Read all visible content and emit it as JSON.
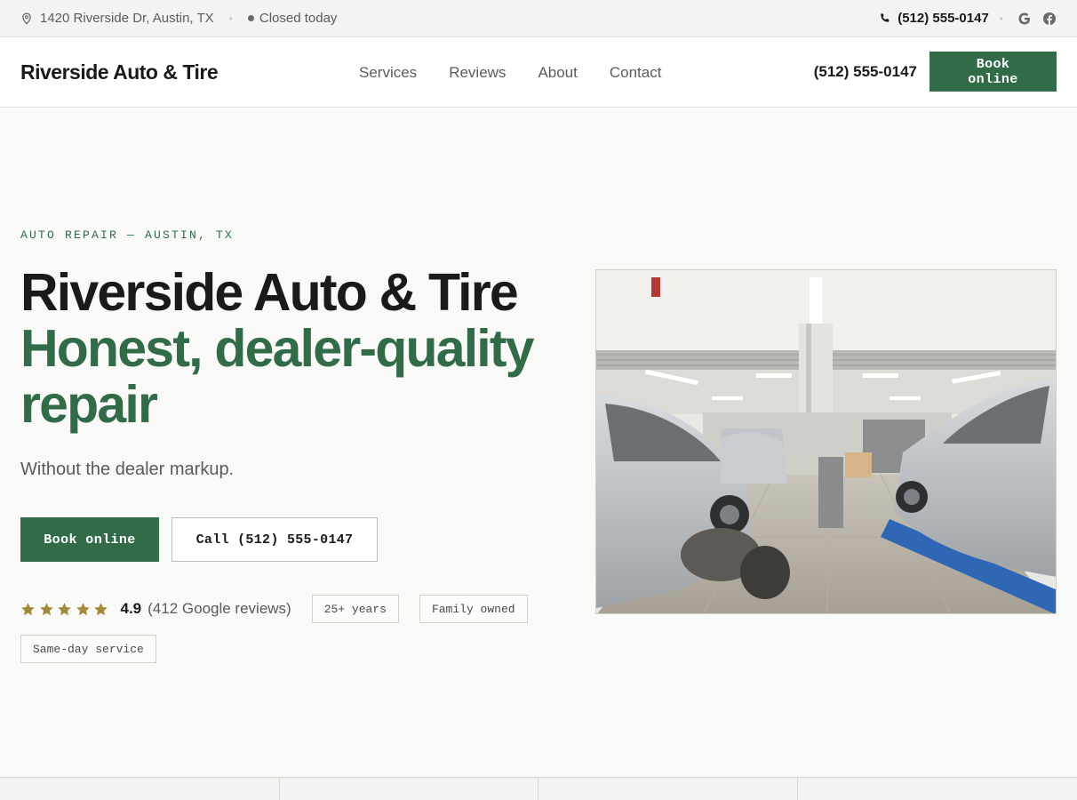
{
  "topbar": {
    "address": "1420 Riverside Dr, Austin, TX",
    "status": "Closed today",
    "phone": "(512) 555-0147",
    "icons": [
      "map-pin-icon",
      "phone-icon",
      "google-icon",
      "facebook-icon"
    ]
  },
  "header": {
    "brand": "Riverside Auto & Tire",
    "nav": [
      "Services",
      "Reviews",
      "About",
      "Contact"
    ],
    "phone": "(512) 555-0147",
    "book_label": "Book online"
  },
  "hero": {
    "eyebrow": "AUTO REPAIR — AUSTIN, TX",
    "headline_line1": "Riverside Auto & Tire",
    "headline_line2": "Honest, dealer-quality repair",
    "subhead": "Without the dealer markup.",
    "primary_cta": "Book online",
    "secondary_cta": "Call (512) 555-0147",
    "rating": {
      "value": "4.9",
      "count": "(412 Google reviews)",
      "stars": 5
    },
    "chips": [
      "25+ years",
      "Family owned",
      "Same-day service"
    ]
  },
  "colors": {
    "accent": "#316b48",
    "star": "#a08a3c",
    "background": "#f9f9f7"
  }
}
